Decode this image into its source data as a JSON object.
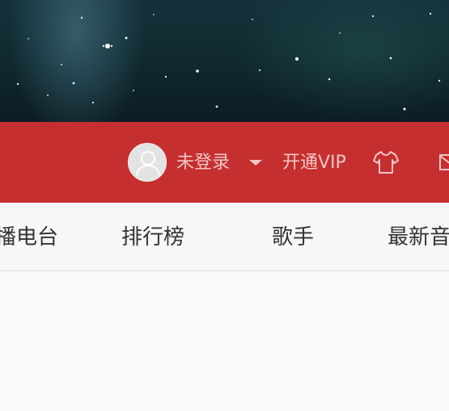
{
  "header": {
    "user": {
      "avatar_icon": "default-user-avatar-icon",
      "login_label": "未登录",
      "dropdown_icon": "caret-down-icon"
    },
    "vip_label": "开通VIP",
    "skin_icon": "tshirt-icon",
    "mail_icon": "envelope-icon"
  },
  "nav": {
    "tabs": [
      {
        "label": "播电台"
      },
      {
        "label": "排行榜"
      },
      {
        "label": "歌手"
      },
      {
        "label": "最新音"
      }
    ]
  },
  "colors": {
    "brand_red": "#c62f2f",
    "header_text": "#f3c6c6",
    "nav_text": "#333333",
    "background": "#f9f9f9"
  }
}
